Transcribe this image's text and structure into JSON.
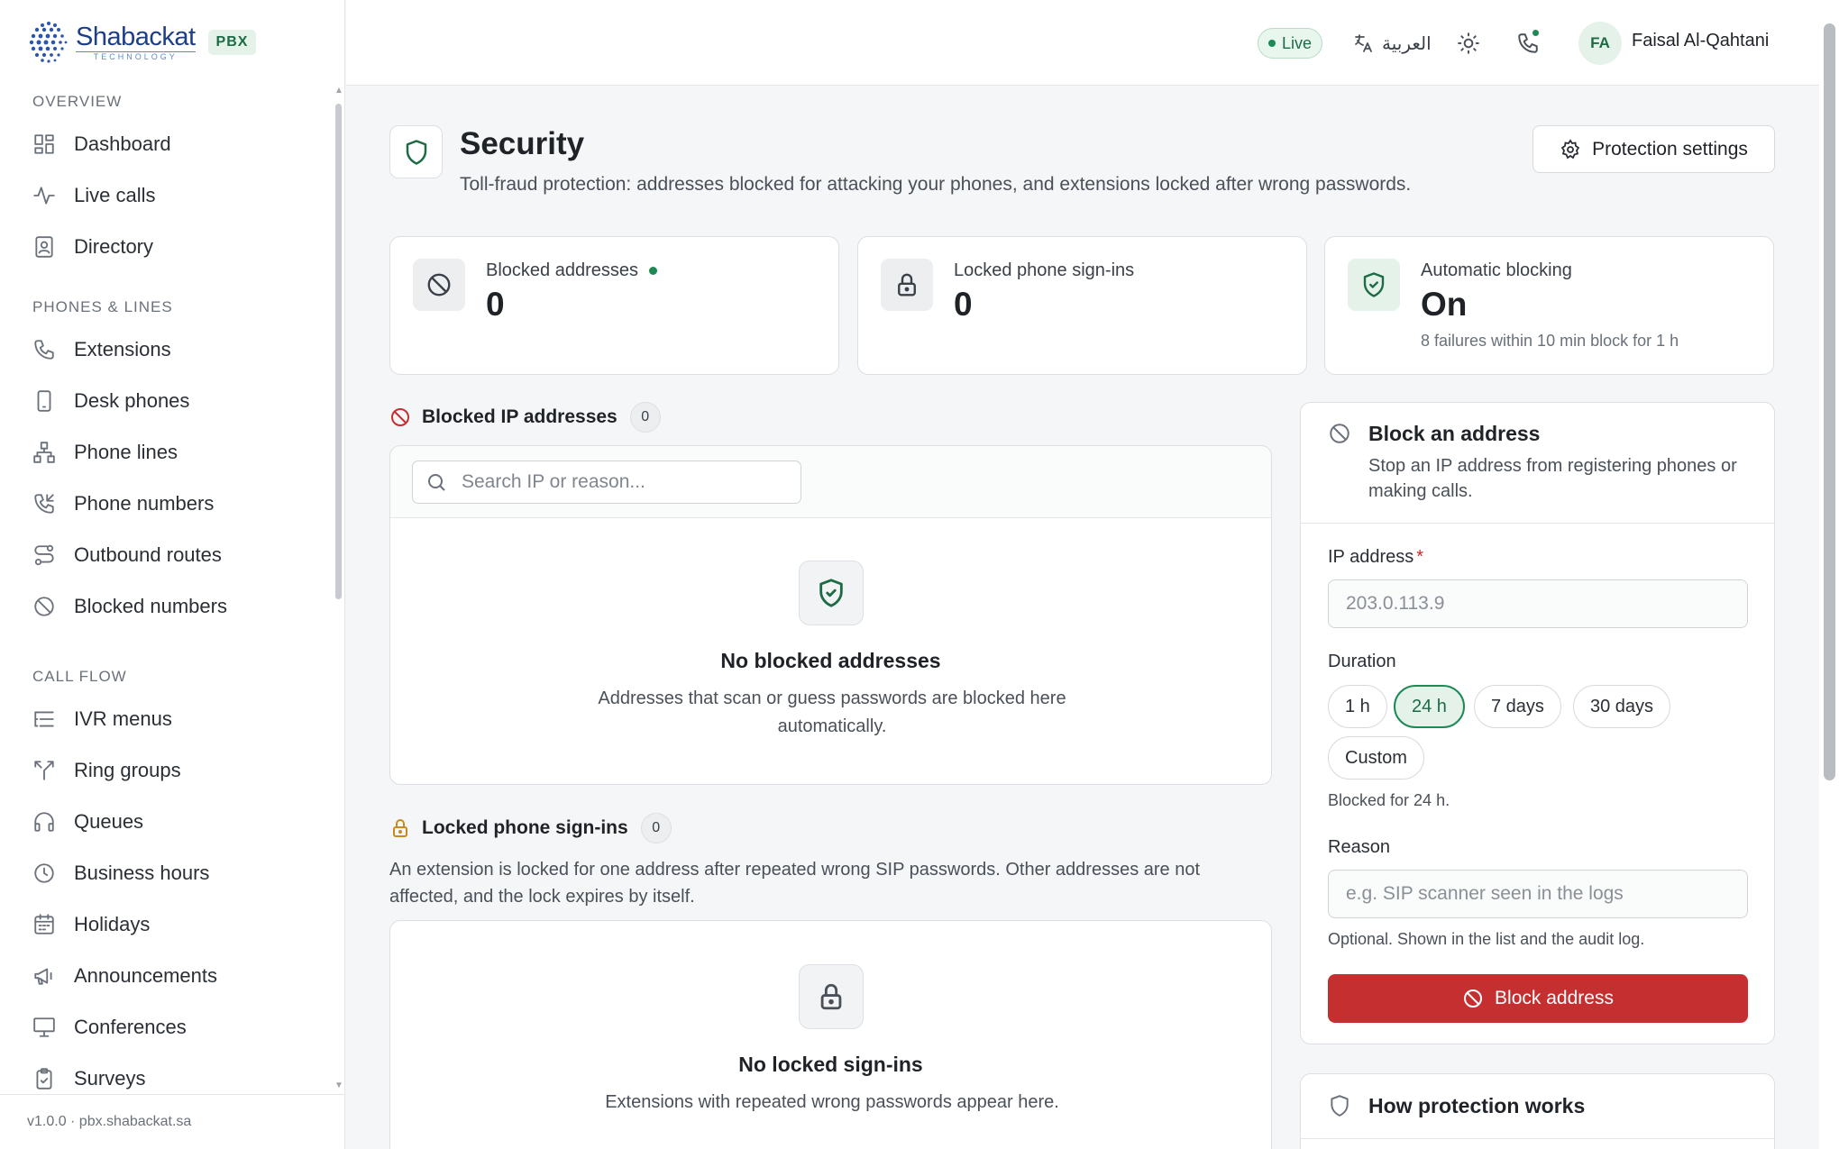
{
  "brand": {
    "name": "Shabackat",
    "tagline": "TECHNOLOGY",
    "badge": "PBX"
  },
  "sidebar": {
    "sections": [
      {
        "title": "OVERVIEW",
        "items": [
          {
            "label": "Dashboard",
            "icon": "dashboard-icon"
          },
          {
            "label": "Live calls",
            "icon": "activity-icon"
          },
          {
            "label": "Directory",
            "icon": "contact-book-icon"
          }
        ]
      },
      {
        "title": "PHONES & LINES",
        "items": [
          {
            "label": "Extensions",
            "icon": "phone-icon"
          },
          {
            "label": "Desk phones",
            "icon": "device-icon"
          },
          {
            "label": "Phone lines",
            "icon": "network-icon"
          },
          {
            "label": "Phone numbers",
            "icon": "phone-incoming-icon"
          },
          {
            "label": "Outbound routes",
            "icon": "route-icon"
          },
          {
            "label": "Blocked numbers",
            "icon": "ban-icon"
          }
        ]
      },
      {
        "title": "CALL FLOW",
        "items": [
          {
            "label": "IVR menus",
            "icon": "list-icon"
          },
          {
            "label": "Ring groups",
            "icon": "split-icon"
          },
          {
            "label": "Queues",
            "icon": "headset-icon"
          },
          {
            "label": "Business hours",
            "icon": "clock-icon"
          },
          {
            "label": "Holidays",
            "icon": "calendar-icon"
          },
          {
            "label": "Announcements",
            "icon": "megaphone-icon"
          },
          {
            "label": "Conferences",
            "icon": "presentation-icon"
          },
          {
            "label": "Surveys",
            "icon": "clipboard-icon"
          }
        ]
      }
    ],
    "footer": "v1.0.0 · pbx.shabackat.sa"
  },
  "header": {
    "status": "Live",
    "language": "العربية",
    "user_initials": "FA",
    "user_name": "Faisal Al-Qahtani"
  },
  "page": {
    "title": "Security",
    "description": "Toll-fraud protection: addresses blocked for attacking your phones, and extensions locked after wrong passwords.",
    "settings_button": "Protection settings"
  },
  "stats": {
    "blocked": {
      "label": "Blocked addresses",
      "value": "0"
    },
    "locked": {
      "label": "Locked phone sign-ins",
      "value": "0"
    },
    "auto": {
      "label": "Automatic blocking",
      "value": "On",
      "note": "8 failures within 10 min block for 1 h"
    }
  },
  "blocked_ips": {
    "title": "Blocked IP addresses",
    "count": "0",
    "search_placeholder": "Search IP or reason...",
    "empty_title": "No blocked addresses",
    "empty_desc": "Addresses that scan or guess passwords are blocked here automatically."
  },
  "locked_signins": {
    "title": "Locked phone sign-ins",
    "count": "0",
    "description": "An extension is locked for one address after repeated wrong SIP passwords. Other addresses are not affected, and the lock expires by itself.",
    "empty_title": "No locked sign-ins",
    "empty_desc": "Extensions with repeated wrong passwords appear here."
  },
  "block_form": {
    "title": "Block an address",
    "subtitle": "Stop an IP address from registering phones or making calls.",
    "ip_label": "IP address",
    "ip_required": "*",
    "ip_placeholder": "203.0.113.9",
    "duration_label": "Duration",
    "durations": [
      "1 h",
      "24 h",
      "7 days",
      "30 days",
      "Custom"
    ],
    "selected_duration": "24 h",
    "duration_hint": "Blocked for 24 h.",
    "reason_label": "Reason",
    "reason_placeholder": "e.g. SIP scanner seen in the logs",
    "reason_hint": "Optional. Shown in the list and the audit log.",
    "submit": "Block address"
  },
  "how": {
    "title": "How protection works"
  },
  "colors": {
    "accent": "#1d8a55",
    "danger": "#c62f2f",
    "brand": "#1d3f8a"
  }
}
